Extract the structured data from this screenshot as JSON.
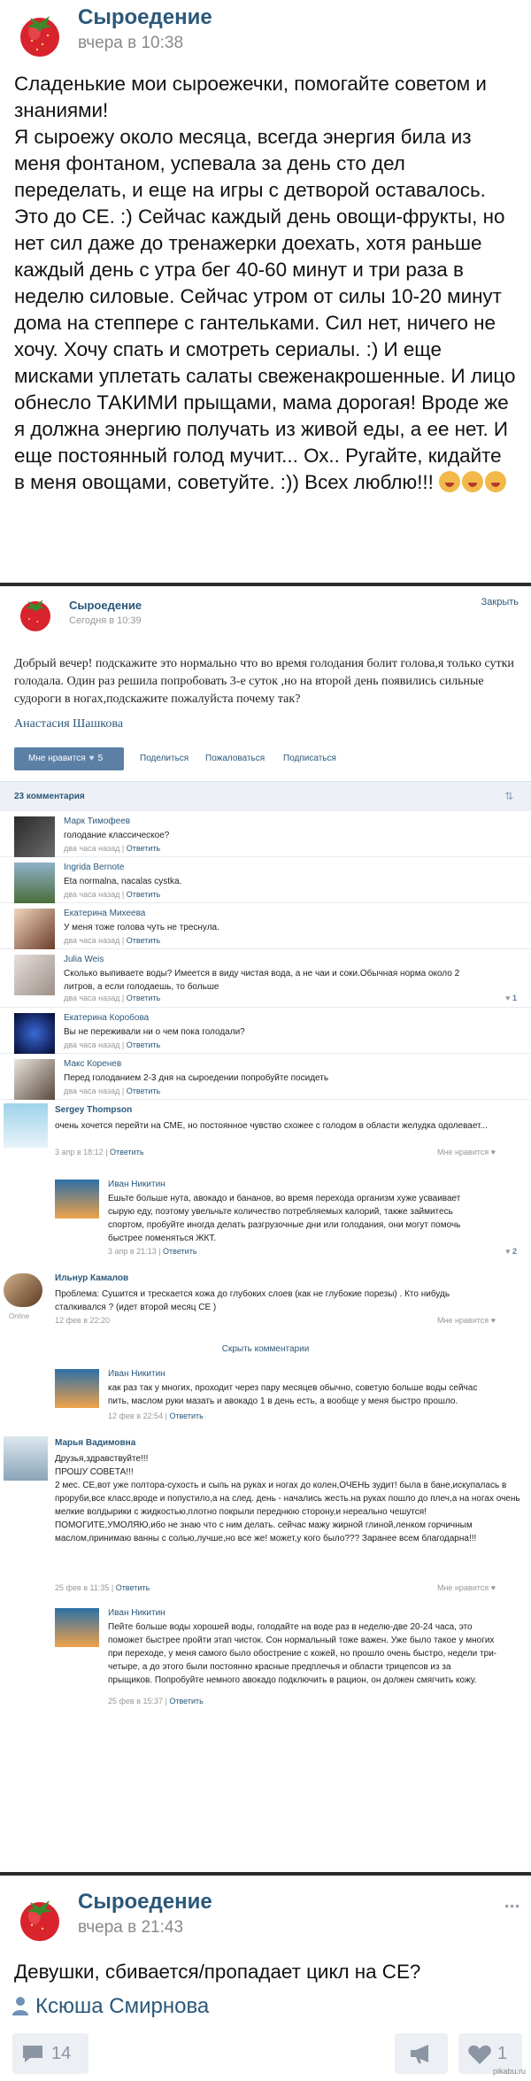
{
  "post1": {
    "group": "Сыроедение",
    "time": "вчера в 10:38",
    "text": "Сладенькие мои сыроежечки, помогайте советом и знаниями!\nЯ сыроежу около месяца, всегда энергия била из меня фонтаном, успевала за день сто дел переделать, и еще на игры с детворой оставалось. Это до СЕ. :) Сейчас каждый день овощи-фрукты, но нет сил даже до тренажерки доехать, хотя раньше каждый день с утра бег 40-60 минут и три раза в неделю силовые. Сейчас утром от силы 10-20 минут дома на степпере с гантельками. Сил нет, ничего не хочу. Хочу спать и смотреть сериалы. :) И еще мисками уплетать салаты свеженакрошенные. И лицо обнесло ТАКИМИ прыщами, мама дорогая! Вроде же я должна энергию получать из живой еды, а ее нет. И еще постоянный голод мучит... Ох.. Ругайте, кидайте в меня овощами, советуйте. :)) Всех люблю!!!"
  },
  "post2": {
    "group": "Сыроедение",
    "time": "Сегодня в 10:39",
    "close_label": "Закрыть",
    "text": "Добрый вечер! подскажите это нормально что во время голодания болит голова,я только сутки голодала. Один раз решила попробовать 3-е суток ,но на второй день появились сильные судороги в ногах,подскажите пожалуйста почему так?",
    "author": "Анастасия Шашкова",
    "like_label": "Мне нравится",
    "like_count": "5",
    "share_label": "Поделиться",
    "complain_label": "Пожаловаться",
    "subscribe_label": "Подписаться",
    "comments_count_label": "23 комментария",
    "comments": [
      {
        "name": "Марк Тимофеев",
        "text": "голодание классическое?",
        "time": "два часа назад",
        "reply": "Ответить"
      },
      {
        "name": "Ingrida Bernote",
        "text": "Eta normalna, nacalas cystka.",
        "time": "два часа назад",
        "reply": "Ответить"
      },
      {
        "name": "Екатерина Михеева",
        "text": "У меня тоже голова чуть не треснула.",
        "time": "два часа назад",
        "reply": "Ответить"
      },
      {
        "name": "Julia Weis",
        "text": "Сколько выпиваете воды? Имеется в виду чистая вода, а не чаи и соки.Обычная норма около 2 литров, а если голодаешь, то больше",
        "time": "два часа назад",
        "reply": "Ответить",
        "likes": "1"
      },
      {
        "name": "Екатерина Коробова",
        "text": "Вы не переживали ни о чем пока голодали?",
        "time": "два часа назад",
        "reply": "Ответить"
      },
      {
        "name": "Макс Коренев",
        "text": "Перед голоданием 2-3 дня на сыроедении попробуйте посидеть",
        "time": "два часа назад",
        "reply": "Ответить"
      }
    ]
  },
  "thread": {
    "c1": {
      "name": "Sergey Thompson",
      "text": "очень хочется перейти на СМЕ, но постоянное чувство схожее с голодом в области желудка одолевает...",
      "time": "3 апр в 18:12",
      "reply": "Ответить",
      "like_label": "Мне нравится"
    },
    "c1r": {
      "name": "Иван Никитин",
      "text": "Ешьте больше нута, авокадо и бананов, во время перехода организм хуже усваивает сырую еду, поэтому увельчьте количество потребляемых калорий, также займитесь спортом, пробуйте иногда делать разгрузочные дни или голодания, они могут помочь быстрее поменяться ЖКТ.",
      "time": "3 апр в 21:13",
      "reply": "Ответить",
      "likes": "2"
    },
    "c2": {
      "name": "Ильнур Камалов",
      "text": "Проблема: Сушится и трескается кожа до глубоких слоев (как не глубокие порезы) . Кто нибудь сталкивался ? (идет второй месяц СЕ )",
      "time": "12 фев в 22:20",
      "online": "Online",
      "like_label": "Мне нравится"
    },
    "hidden_label": "Скрыть комментарии",
    "c2r": {
      "name": "Иван Никитин",
      "text": "как раз так у многих, проходит через пару месяцев обычно, советую больше воды сейчас пить, маслом руки мазать и авокадо 1 в день есть, а вообще у меня быстро прошло.",
      "time": "12 фев в 22:54",
      "reply": "Ответить"
    },
    "c3": {
      "name": "Марья Вадимовна",
      "text": "Друзья,здравствуйте!!!\nПРОШУ СОВЕТА!!!\n2 мес. СЕ,вот уже полтора-сухость и сыпь на руках и ногах до колен,ОЧЕНЬ зудит! была в бане,искупалась в проруби,все класс,вроде и попустило,а на след. день - начались жесть.на руках пошло до плеч,а на ногах очень мелкие волдырики с жидкостью,плотно покрыли переднюю сторону,и нереально чешутся! ПОМОГИТЕ,УМОЛЯЮ,ибо не знаю что с ним делать. сейчас мажу жирной глиной,ленком горчичным маслом,принимаю ванны с солью,лучше,но все же! может,у кого было??? Заранее всем благодарна!!!",
      "time": "25 фев в 11:35",
      "reply": "Ответить",
      "like_label": "Мне нравится"
    },
    "c3r": {
      "name": "Иван Никитин",
      "text": "Пейте больше воды хорошей воды, голодайте на воде раз в неделю-две 20-24 часа, это поможет быстрее пройти этап чисток. Сон нормальный тоже важен. Уже было такое у многих при переходе, у меня самого было обострение с кожей, но прошло очень быстро, недели три-четыре, а до этого были постоянно красные предплечья и области трицепсов из за прыщиков. Попробуйте немного авокадо подключить в рацион, он должен смягчить кожу.",
      "time": "25 фев в 15:37",
      "reply": "Ответить"
    }
  },
  "post3": {
    "group": "Сыроедение",
    "time": "вчера в 21:43",
    "text": "Девушки, сбивается/пропадает цикл на СЕ?",
    "author": "Ксюша Смирнова",
    "comments_count": "14",
    "likes_count": "1"
  },
  "watermark": "pikabu.ru",
  "icons": {
    "avatar": "strawberry-icon",
    "comment": "comment-icon",
    "share": "megaphone-icon",
    "like": "heart-icon",
    "person": "person-icon"
  },
  "colors": {
    "link": "#2b587a",
    "accent": "#5c7fa6"
  }
}
